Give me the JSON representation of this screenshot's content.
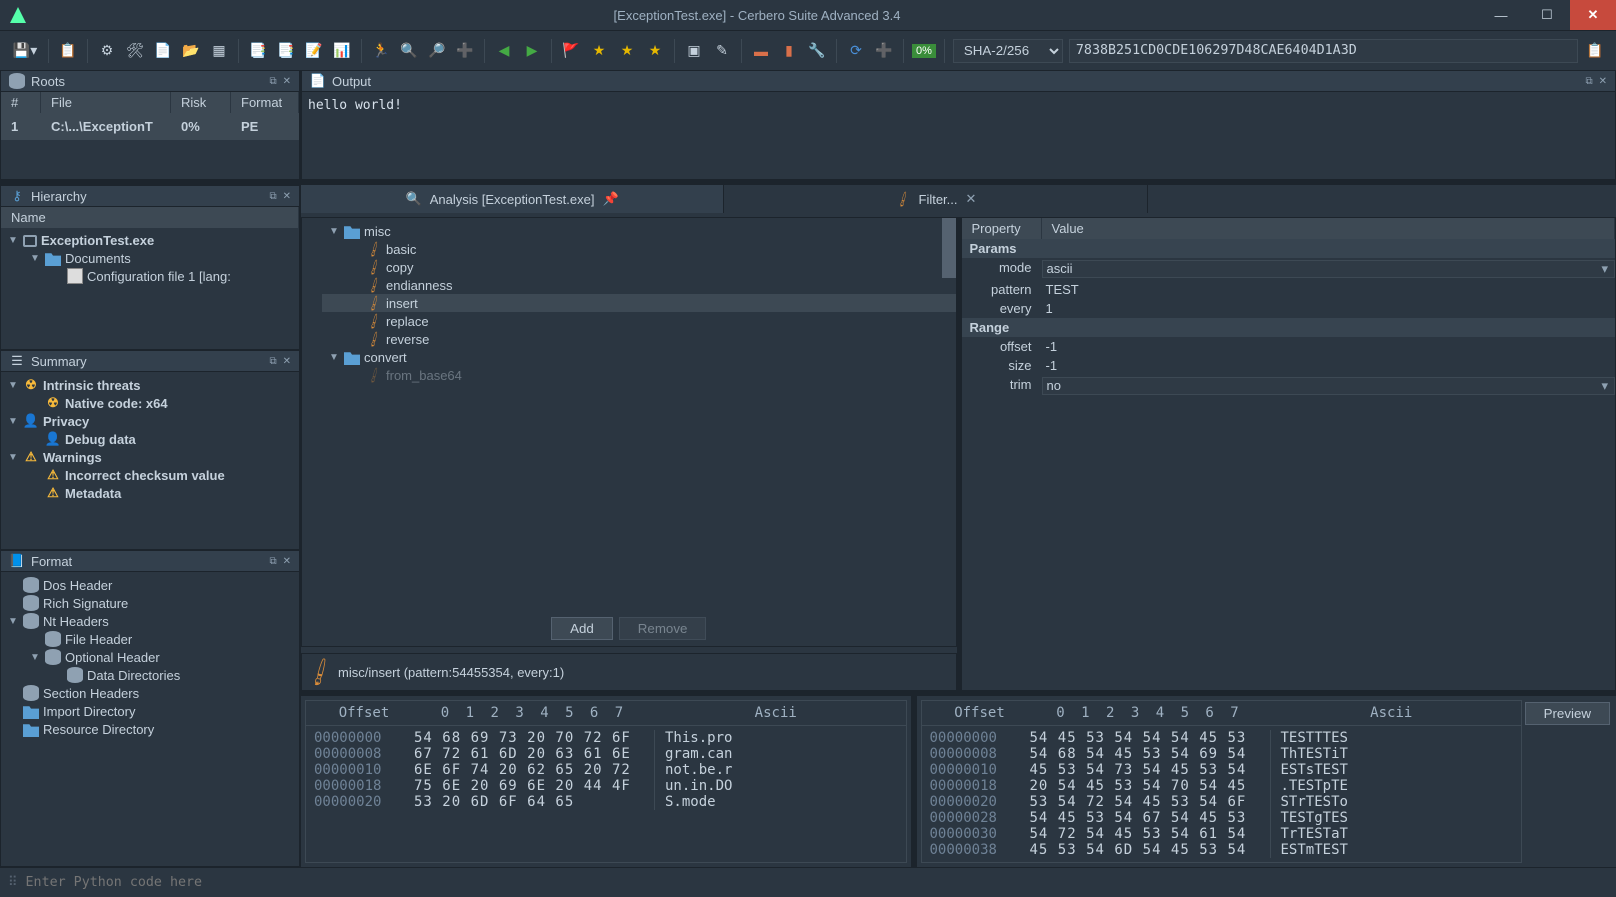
{
  "titlebar": {
    "title": "[ExceptionTest.exe] - Cerbero Suite Advanced 3.4",
    "close": "✕",
    "min": "—",
    "max": "☐"
  },
  "toolbar": {
    "hash_algo": "SHA-2/256",
    "hash_value": "7838B251CD0CDE106297D48CAE6404D1A3D",
    "pct_badge": "0%"
  },
  "roots": {
    "title": "Roots",
    "cols": [
      "#",
      "File",
      "Risk",
      "Format"
    ],
    "row": {
      "num": "1",
      "file": "C:\\...\\ExceptionT",
      "risk": "0%",
      "format": "PE"
    }
  },
  "output": {
    "title": "Output",
    "text": "hello world!"
  },
  "hierarchy": {
    "title": "Hierarchy",
    "head": "Name",
    "items": [
      {
        "indent": 0,
        "caret": "▼",
        "icon": "mon",
        "label": "ExceptionTest.exe",
        "bold": true
      },
      {
        "indent": 1,
        "caret": "▼",
        "icon": "folder",
        "label": "Documents"
      },
      {
        "indent": 2,
        "caret": "",
        "icon": "file",
        "label": "Configuration file 1 [lang:"
      }
    ]
  },
  "summary": {
    "title": "Summary",
    "items": [
      {
        "indent": 0,
        "caret": "▼",
        "icon": "rad",
        "label": "Intrinsic threats",
        "bold": true
      },
      {
        "indent": 1,
        "caret": "",
        "icon": "rad",
        "label": "Native code: x64",
        "bold": true
      },
      {
        "indent": 0,
        "caret": "▼",
        "icon": "priv",
        "label": "Privacy",
        "bold": true
      },
      {
        "indent": 1,
        "caret": "",
        "icon": "priv",
        "label": "Debug data",
        "bold": true
      },
      {
        "indent": 0,
        "caret": "▼",
        "icon": "warn",
        "label": "Warnings",
        "bold": true
      },
      {
        "indent": 1,
        "caret": "",
        "icon": "warn",
        "label": "Incorrect checksum value",
        "bold": true
      },
      {
        "indent": 1,
        "caret": "",
        "icon": "warn",
        "label": "Metadata",
        "bold": true
      }
    ]
  },
  "format": {
    "title": "Format",
    "items": [
      {
        "indent": 0,
        "caret": "",
        "icon": "db",
        "label": "Dos Header"
      },
      {
        "indent": 0,
        "caret": "",
        "icon": "db",
        "label": "Rich Signature"
      },
      {
        "indent": 0,
        "caret": "▼",
        "icon": "db",
        "label": "Nt Headers"
      },
      {
        "indent": 1,
        "caret": "",
        "icon": "db",
        "label": "File Header"
      },
      {
        "indent": 1,
        "caret": "▼",
        "icon": "db",
        "label": "Optional Header"
      },
      {
        "indent": 2,
        "caret": "",
        "icon": "db",
        "label": "Data Directories"
      },
      {
        "indent": 0,
        "caret": "",
        "icon": "db",
        "label": "Section Headers"
      },
      {
        "indent": 0,
        "caret": "",
        "icon": "folder",
        "label": "Import Directory"
      },
      {
        "indent": 0,
        "caret": "",
        "icon": "folder",
        "label": "Resource Directory"
      }
    ]
  },
  "tabs": {
    "analysis": "Analysis [ExceptionTest.exe]",
    "filter": "Filter..."
  },
  "filterTree": [
    {
      "indent": 0,
      "caret": "▼",
      "icon": "folder",
      "label": "misc"
    },
    {
      "indent": 1,
      "caret": "",
      "icon": "brush",
      "label": "basic"
    },
    {
      "indent": 1,
      "caret": "",
      "icon": "brush",
      "label": "copy"
    },
    {
      "indent": 1,
      "caret": "",
      "icon": "brush",
      "label": "endianness"
    },
    {
      "indent": 1,
      "caret": "",
      "icon": "brush",
      "label": "insert",
      "sel": true
    },
    {
      "indent": 1,
      "caret": "",
      "icon": "brush",
      "label": "replace"
    },
    {
      "indent": 1,
      "caret": "",
      "icon": "brush",
      "label": "reverse"
    },
    {
      "indent": 0,
      "caret": "▼",
      "icon": "folder",
      "label": "convert"
    },
    {
      "indent": 1,
      "caret": "",
      "icon": "brush",
      "label": "from_base64",
      "fade": true
    }
  ],
  "filterBtns": {
    "add": "Add",
    "remove": "Remove"
  },
  "applied": "misc/insert (pattern:54455354, every:1)",
  "props": {
    "headProp": "Property",
    "headVal": "Value",
    "sectParams": "Params",
    "rows1": [
      {
        "k": "mode",
        "v": "ascii",
        "combo": true
      },
      {
        "k": "pattern",
        "v": "TEST"
      },
      {
        "k": "every",
        "v": "1"
      }
    ],
    "sectRange": "Range",
    "rows2": [
      {
        "k": "offset",
        "v": "-1"
      },
      {
        "k": "size",
        "v": "-1"
      },
      {
        "k": "trim",
        "v": "no",
        "combo": true
      }
    ]
  },
  "previewBtn": "Preview",
  "hexLeft": {
    "head": {
      "off": "Offset",
      "bytes": "0  1  2  3  4  5  6  7",
      "asc": "Ascii"
    },
    "rows": [
      {
        "o": "00000000",
        "b": "54 68 69 73 20 70 72 6F",
        "a": "This.pro"
      },
      {
        "o": "00000008",
        "b": "67 72 61 6D 20 63 61 6E",
        "a": "gram.can"
      },
      {
        "o": "00000010",
        "b": "6E 6F 74 20 62 65 20 72",
        "a": "not.be.r"
      },
      {
        "o": "00000018",
        "b": "75 6E 20 69 6E 20 44 4F",
        "a": "un.in.DO"
      },
      {
        "o": "00000020",
        "b": "53 20 6D 6F 64 65",
        "a": "S.mode"
      }
    ]
  },
  "hexRight": {
    "head": {
      "off": "Offset",
      "bytes": "0  1  2  3  4  5  6  7",
      "asc": "Ascii"
    },
    "rows": [
      {
        "o": "00000000",
        "b": "54 45 53 54 54 54 45 53",
        "a": "TESTTTES"
      },
      {
        "o": "00000008",
        "b": "54 68 54 45 53 54 69 54",
        "a": "ThTESTiT"
      },
      {
        "o": "00000010",
        "b": "45 53 54 73 54 45 53 54",
        "a": "ESTsTEST"
      },
      {
        "o": "00000018",
        "b": "20 54 45 53 54 70 54 45",
        "a": ".TESTpTE"
      },
      {
        "o": "00000020",
        "b": "53 54 72 54 45 53 54 6F",
        "a": "STrTESTo"
      },
      {
        "o": "00000028",
        "b": "54 45 53 54 67 54 45 53",
        "a": "TESTgTES"
      },
      {
        "o": "00000030",
        "b": "54 72 54 45 53 54 61 54",
        "a": "TrTESTaT"
      },
      {
        "o": "00000038",
        "b": "45 53 54 6D 54 45 53 54",
        "a": "ESTmTEST"
      }
    ]
  },
  "pycon": {
    "prompt": "⠿",
    "placeholder": "Enter Python code here"
  }
}
